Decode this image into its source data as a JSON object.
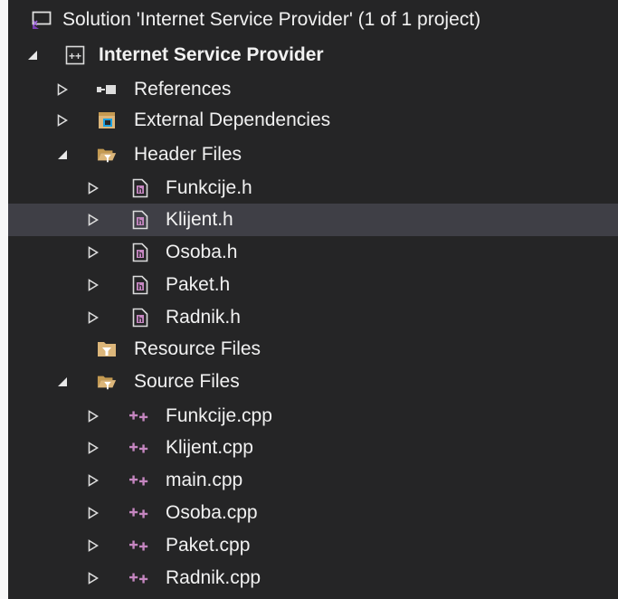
{
  "colors": {
    "background": "#252526",
    "text": "#f1f1f1",
    "selected_row": "#3f3f46",
    "folder": "#dcb67a",
    "filter": "#e4a62f",
    "cpp_icon": "#c586c0",
    "solution_icon": "#68217a"
  },
  "tree": {
    "solution": {
      "label": "Solution 'Internet Service Provider' (1 of 1 project)",
      "icon": "solution-icon"
    },
    "project": {
      "label": "Internet Service Provider",
      "icon": "cpp-project-icon",
      "expanded": true
    },
    "references": {
      "label": "References",
      "icon": "references-icon",
      "expanded": false
    },
    "external": {
      "label": "External Dependencies",
      "icon": "external-dependencies-icon",
      "expanded": false
    },
    "header_folder": {
      "label": "Header Files",
      "icon": "filter-folder-open-icon",
      "expanded": true,
      "files": [
        {
          "label": "Funkcije.h",
          "icon": "header-file-icon"
        },
        {
          "label": "Klijent.h",
          "icon": "header-file-icon",
          "selected": true
        },
        {
          "label": "Osoba.h",
          "icon": "header-file-icon"
        },
        {
          "label": "Paket.h",
          "icon": "header-file-icon"
        },
        {
          "label": "Radnik.h",
          "icon": "header-file-icon"
        }
      ]
    },
    "resource_folder": {
      "label": "Resource Files",
      "icon": "filter-folder-icon"
    },
    "source_folder": {
      "label": "Source Files",
      "icon": "filter-folder-open-icon",
      "expanded": true,
      "files": [
        {
          "label": "Funkcije.cpp",
          "icon": "cpp-file-icon"
        },
        {
          "label": "Klijent.cpp",
          "icon": "cpp-file-icon"
        },
        {
          "label": "main.cpp",
          "icon": "cpp-file-icon"
        },
        {
          "label": "Osoba.cpp",
          "icon": "cpp-file-icon"
        },
        {
          "label": "Paket.cpp",
          "icon": "cpp-file-icon"
        },
        {
          "label": "Radnik.cpp",
          "icon": "cpp-file-icon"
        }
      ]
    }
  }
}
